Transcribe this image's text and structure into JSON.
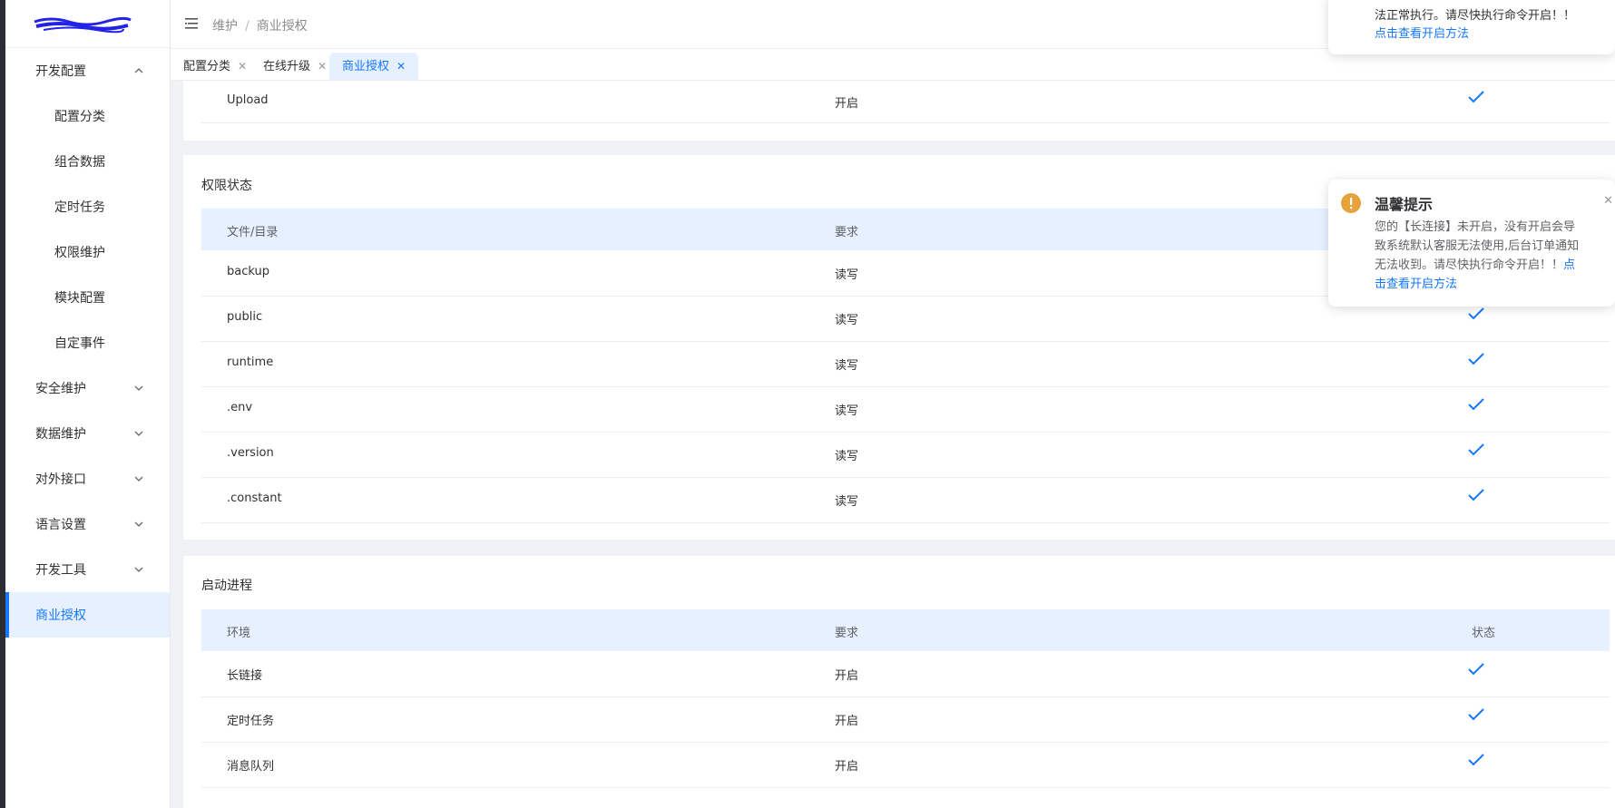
{
  "sidebar": {
    "menu": [
      {
        "label": "开发配置",
        "expanded": true
      },
      {
        "label": "配置分类"
      },
      {
        "label": "组合数据"
      },
      {
        "label": "定时任务"
      },
      {
        "label": "权限维护"
      },
      {
        "label": "模块配置"
      },
      {
        "label": "自定事件"
      },
      {
        "label": "安全维护"
      },
      {
        "label": "数据维护"
      },
      {
        "label": "对外接口"
      },
      {
        "label": "语言设置"
      },
      {
        "label": "开发工具"
      },
      {
        "label": "商业授权",
        "active": true
      }
    ]
  },
  "header": {
    "breadcrumb": [
      "维护",
      "/",
      "商业授权"
    ]
  },
  "tabs": [
    {
      "label": "配置分类",
      "close": "✕"
    },
    {
      "label": "在线升级",
      "close": "✕"
    },
    {
      "label": "商业授权",
      "close": "✕",
      "active": true
    }
  ],
  "top_section": {
    "row": {
      "name": "Upload",
      "requirement": "开启"
    }
  },
  "permission_section": {
    "title": "权限状态",
    "headers": [
      "文件/目录",
      "要求"
    ],
    "rows": [
      {
        "name": "backup",
        "requirement": "读写"
      },
      {
        "name": "public",
        "requirement": "读写"
      },
      {
        "name": "runtime",
        "requirement": "读写"
      },
      {
        "name": ".env",
        "requirement": "读写"
      },
      {
        "name": ".version",
        "requirement": "读写"
      },
      {
        "name": ".constant",
        "requirement": "读写"
      }
    ]
  },
  "process_section": {
    "title": "启动进程",
    "headers": [
      "环境",
      "要求",
      "状态"
    ],
    "rows": [
      {
        "name": "长链接",
        "requirement": "开启"
      },
      {
        "name": "定时任务",
        "requirement": "开启"
      },
      {
        "name": "消息队列",
        "requirement": "开启"
      }
    ]
  },
  "toast_top": {
    "text": "法正常执行。请尽快执行命令开启！！",
    "link": "点击查看开启方法"
  },
  "toast_main": {
    "title": "温馨提示",
    "body_lines": [
      "您的【长连接】未开启，没有开启会导",
      "致系统默认客服无法使用,后台订单通知",
      "无法收到。请尽快执行命令开启！！"
    ],
    "link_inline": "点",
    "link_line": "击查看开启方法",
    "close": "✕"
  },
  "colors": {
    "accent": "#1677ff",
    "warning": "#e6a23c",
    "header_row": "#e6f0ff"
  }
}
